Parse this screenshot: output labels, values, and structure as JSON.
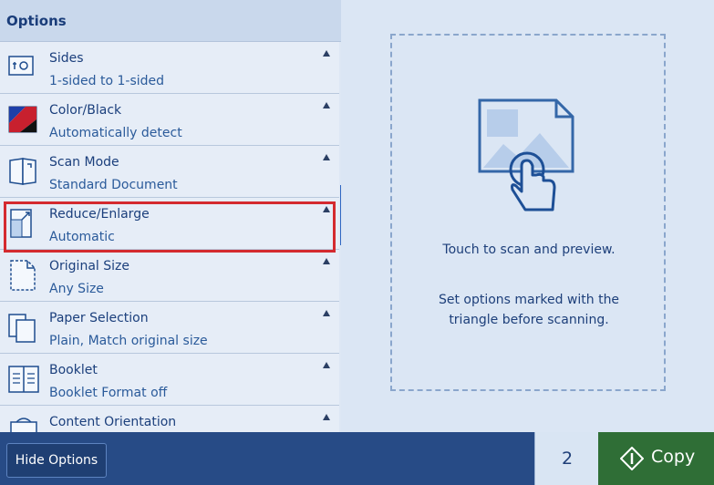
{
  "options_panel": {
    "header": "Options",
    "items": [
      {
        "title": "Sides",
        "value": "1-sided to 1-sided",
        "icon": "sides-icon"
      },
      {
        "title": "Color/Black",
        "value": "Automatically detect",
        "icon": "color-black-icon"
      },
      {
        "title": "Scan Mode",
        "value": "Standard Document",
        "icon": "scan-mode-icon"
      },
      {
        "title": "Reduce/Enlarge",
        "value": "Automatic",
        "icon": "reduce-enlarge-icon"
      },
      {
        "title": "Original Size",
        "value": "Any Size",
        "icon": "original-size-icon"
      },
      {
        "title": "Paper Selection",
        "value": "Plain, Match original size",
        "icon": "paper-selection-icon"
      },
      {
        "title": "Booklet",
        "value": "Booklet Format off",
        "icon": "booklet-icon"
      },
      {
        "title": "Content Orientation",
        "value": "",
        "icon": "content-orientation-icon"
      }
    ]
  },
  "preview": {
    "line1": "Touch to scan and preview.",
    "line2a": "Set options marked with the",
    "line2b": "triangle before scanning."
  },
  "footer": {
    "hide_options": "Hide Options",
    "copies": "2",
    "copy_label": "Copy"
  },
  "colors": {
    "highlight": "#d42a2f",
    "copy_button": "#2f6e36",
    "accent": "#2f67c2"
  }
}
